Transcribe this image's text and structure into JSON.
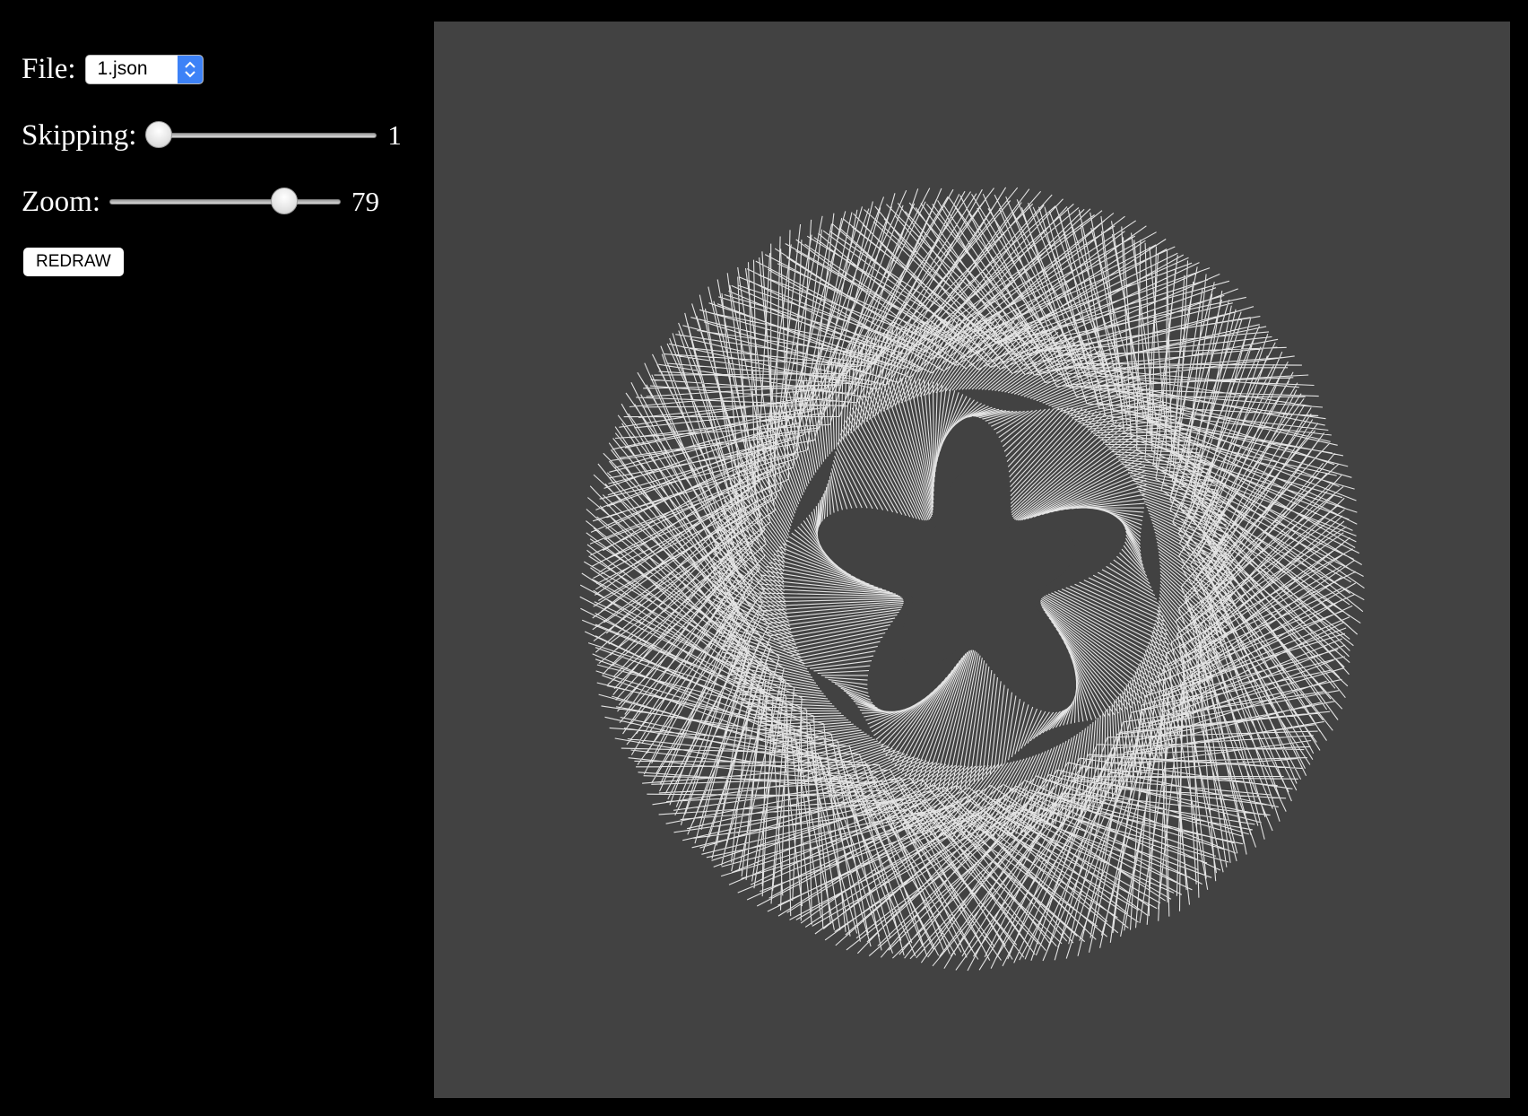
{
  "controls": {
    "file": {
      "label": "File:",
      "selected": "1.json",
      "icon": "select-arrows-icon"
    },
    "skipping": {
      "label": "Skipping:",
      "value": "1",
      "min": 1,
      "max": 50
    },
    "zoom": {
      "label": "Zoom:",
      "value": "79",
      "min": 1,
      "max": 100
    },
    "redraw_label": "REDRAW"
  },
  "colors": {
    "page_background": "#000000",
    "canvas_background": "#424242",
    "stroke": "#ffffff",
    "select_accent": "#3d82f7"
  }
}
